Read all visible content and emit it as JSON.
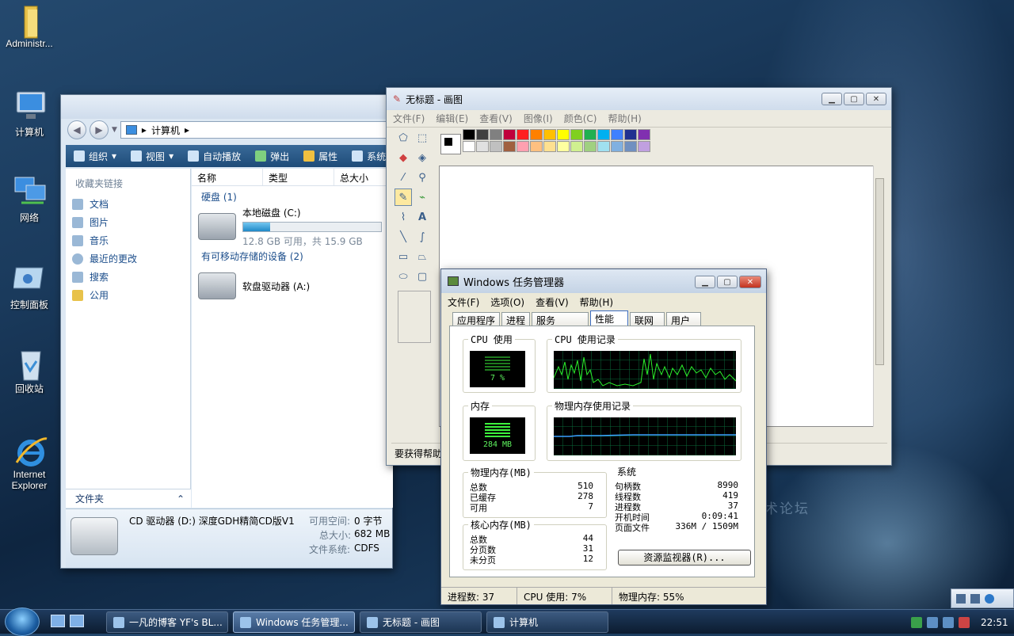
{
  "desktop": {
    "icons": [
      {
        "label": "Administr...",
        "icon": "folder-icon"
      },
      {
        "label": "计算机",
        "icon": "computer-icon"
      },
      {
        "label": "网络",
        "icon": "network-icon"
      },
      {
        "label": "控制面板",
        "icon": "control-panel-icon"
      },
      {
        "label": "回收站",
        "icon": "recycle-bin-icon"
      },
      {
        "label": "Internet Explorer",
        "icon": "internet-explorer-icon"
      }
    ],
    "watermark": "术论坛"
  },
  "explorer": {
    "address": "计算机",
    "toolbar": [
      "组织",
      "视图",
      "自动播放",
      "弹出",
      "属性",
      "系统"
    ],
    "fav_header": "收藏夹链接",
    "favorites": [
      "文档",
      "图片",
      "音乐",
      "最近的更改",
      "搜索",
      "公用"
    ],
    "folders_label": "文件夹",
    "columns": [
      "名称",
      "类型",
      "总大小"
    ],
    "group_hdd": "硬盘 (1)",
    "drive_c_name": "本地磁盘 (C:)",
    "drive_c_space": "12.8 GB 可用，共 15.9 GB",
    "drive_c_used_fraction": 0.195,
    "group_removable": "有可移动存储的设备 (2)",
    "drive_a_name": "软盘驱动器 (A:)",
    "details": {
      "name": "CD 驱动器 (D:) 深度GDH精简CD版V1",
      "free_label": "可用空间:",
      "free_value": "0 字节",
      "total_label": "总大小:",
      "total_value": "682 MB",
      "fs_label": "文件系统:",
      "fs_value": "CDFS"
    }
  },
  "paint": {
    "title": "无标题 - 画图",
    "menu": [
      "文件(F)",
      "编辑(E)",
      "查看(V)",
      "图像(I)",
      "颜色(C)",
      "帮助(H)"
    ],
    "status": "要获得帮助",
    "palette_top": [
      "#000000",
      "#404040",
      "#808080",
      "#c0003c",
      "#ff2020",
      "#ff8000",
      "#ffc000",
      "#ffff00",
      "#80d020",
      "#20b050",
      "#00b0f0",
      "#4080ff",
      "#203090",
      "#8030b0"
    ],
    "palette_bottom": [
      "#ffffff",
      "#e0e0e0",
      "#c0c0c0",
      "#a06040",
      "#ffa0b0",
      "#ffc080",
      "#ffe090",
      "#ffffa0",
      "#d0f090",
      "#a0d080",
      "#a0e0f0",
      "#80b0e0",
      "#7090c0",
      "#c0a0e0"
    ]
  },
  "taskmgr": {
    "title": "Windows 任务管理器",
    "menu": [
      "文件(F)",
      "选项(O)",
      "查看(V)",
      "帮助(H)"
    ],
    "tabs": [
      "应用程序",
      "进程",
      "服务",
      "性能",
      "联网",
      "用户"
    ],
    "active_tab": 3,
    "cpu_usage_label": "CPU 使用",
    "cpu_usage_value": "7 %",
    "cpu_history_label": "CPU 使用记录",
    "mem_label": "内存",
    "mem_value": "284 MB",
    "mem_history_label": "物理内存使用记录",
    "physical": {
      "title": "物理内存(MB)",
      "rows": [
        [
          "总数",
          "510"
        ],
        [
          "已缓存",
          "278"
        ],
        [
          "可用",
          "7"
        ]
      ]
    },
    "kernel": {
      "title": "核心内存(MB)",
      "rows": [
        [
          "总数",
          "44"
        ],
        [
          "分页数",
          "31"
        ],
        [
          "未分页",
          "12"
        ]
      ]
    },
    "system": {
      "title": "系统",
      "rows": [
        [
          "句柄数",
          "8990"
        ],
        [
          "线程数",
          "419"
        ],
        [
          "进程数",
          "37"
        ],
        [
          "开机时间",
          "0:09:41"
        ],
        [
          "页面文件",
          "336M / 1509M"
        ]
      ]
    },
    "resource_button": "资源监视器(R)...",
    "status": [
      "进程数: 37",
      "CPU 使用: 7%",
      "物理内存: 55%"
    ]
  },
  "taskbar": {
    "buttons": [
      {
        "label": "一凡的博客 YF's BL...",
        "active": false
      },
      {
        "label": "Windows 任务管理...",
        "active": true
      },
      {
        "label": "无标题 - 画图",
        "active": false
      },
      {
        "label": "计算机",
        "active": false
      }
    ],
    "clock": "22:51"
  }
}
